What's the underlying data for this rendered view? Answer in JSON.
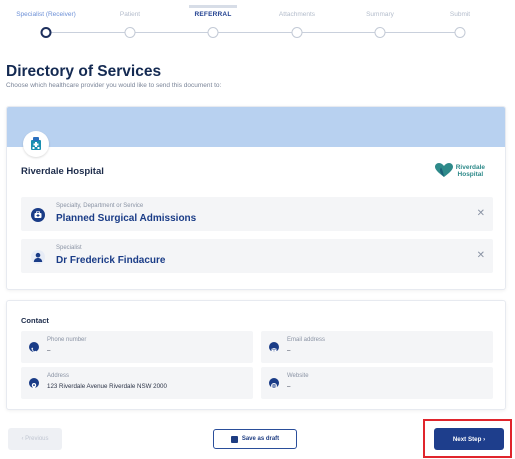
{
  "stepper": {
    "steps": [
      {
        "label": "Specialist (Receiver)"
      },
      {
        "label": "Patient"
      },
      {
        "label": "REFERRAL"
      },
      {
        "label": "Attachments"
      },
      {
        "label": "Summary"
      },
      {
        "label": "Submit"
      }
    ],
    "active_index": 0
  },
  "header": {
    "title": "Directory of Services",
    "subtitle": "Choose which healthcare provider you would like to send this document to:"
  },
  "provider": {
    "name": "Riverdale Hospital",
    "logo_line1": "Riverdale",
    "logo_line2": "Hospital",
    "specialty_label": "Specialty, Department or Service",
    "specialty_value": "Planned Surgical Admissions",
    "specialist_label": "Specialist",
    "specialist_value": "Dr Frederick Findacure",
    "close_glyph": "✕"
  },
  "contact": {
    "title": "Contact",
    "phone_label": "Phone number",
    "phone_value": "–",
    "email_label": "Email address",
    "email_value": "–",
    "address_label": "Address",
    "address_value": "123 Riverdale Avenue Riverdale NSW 2000",
    "website_label": "Website",
    "website_value": "–"
  },
  "footer": {
    "previous_label": "‹  Previous",
    "save_label": "Save as draft",
    "next_label": "Next Step  ›"
  },
  "colors": {
    "accent": "#1e3e8c",
    "banner": "#b8d1f0",
    "highlight": "#e0252c",
    "logo": "#2e8a8a"
  }
}
